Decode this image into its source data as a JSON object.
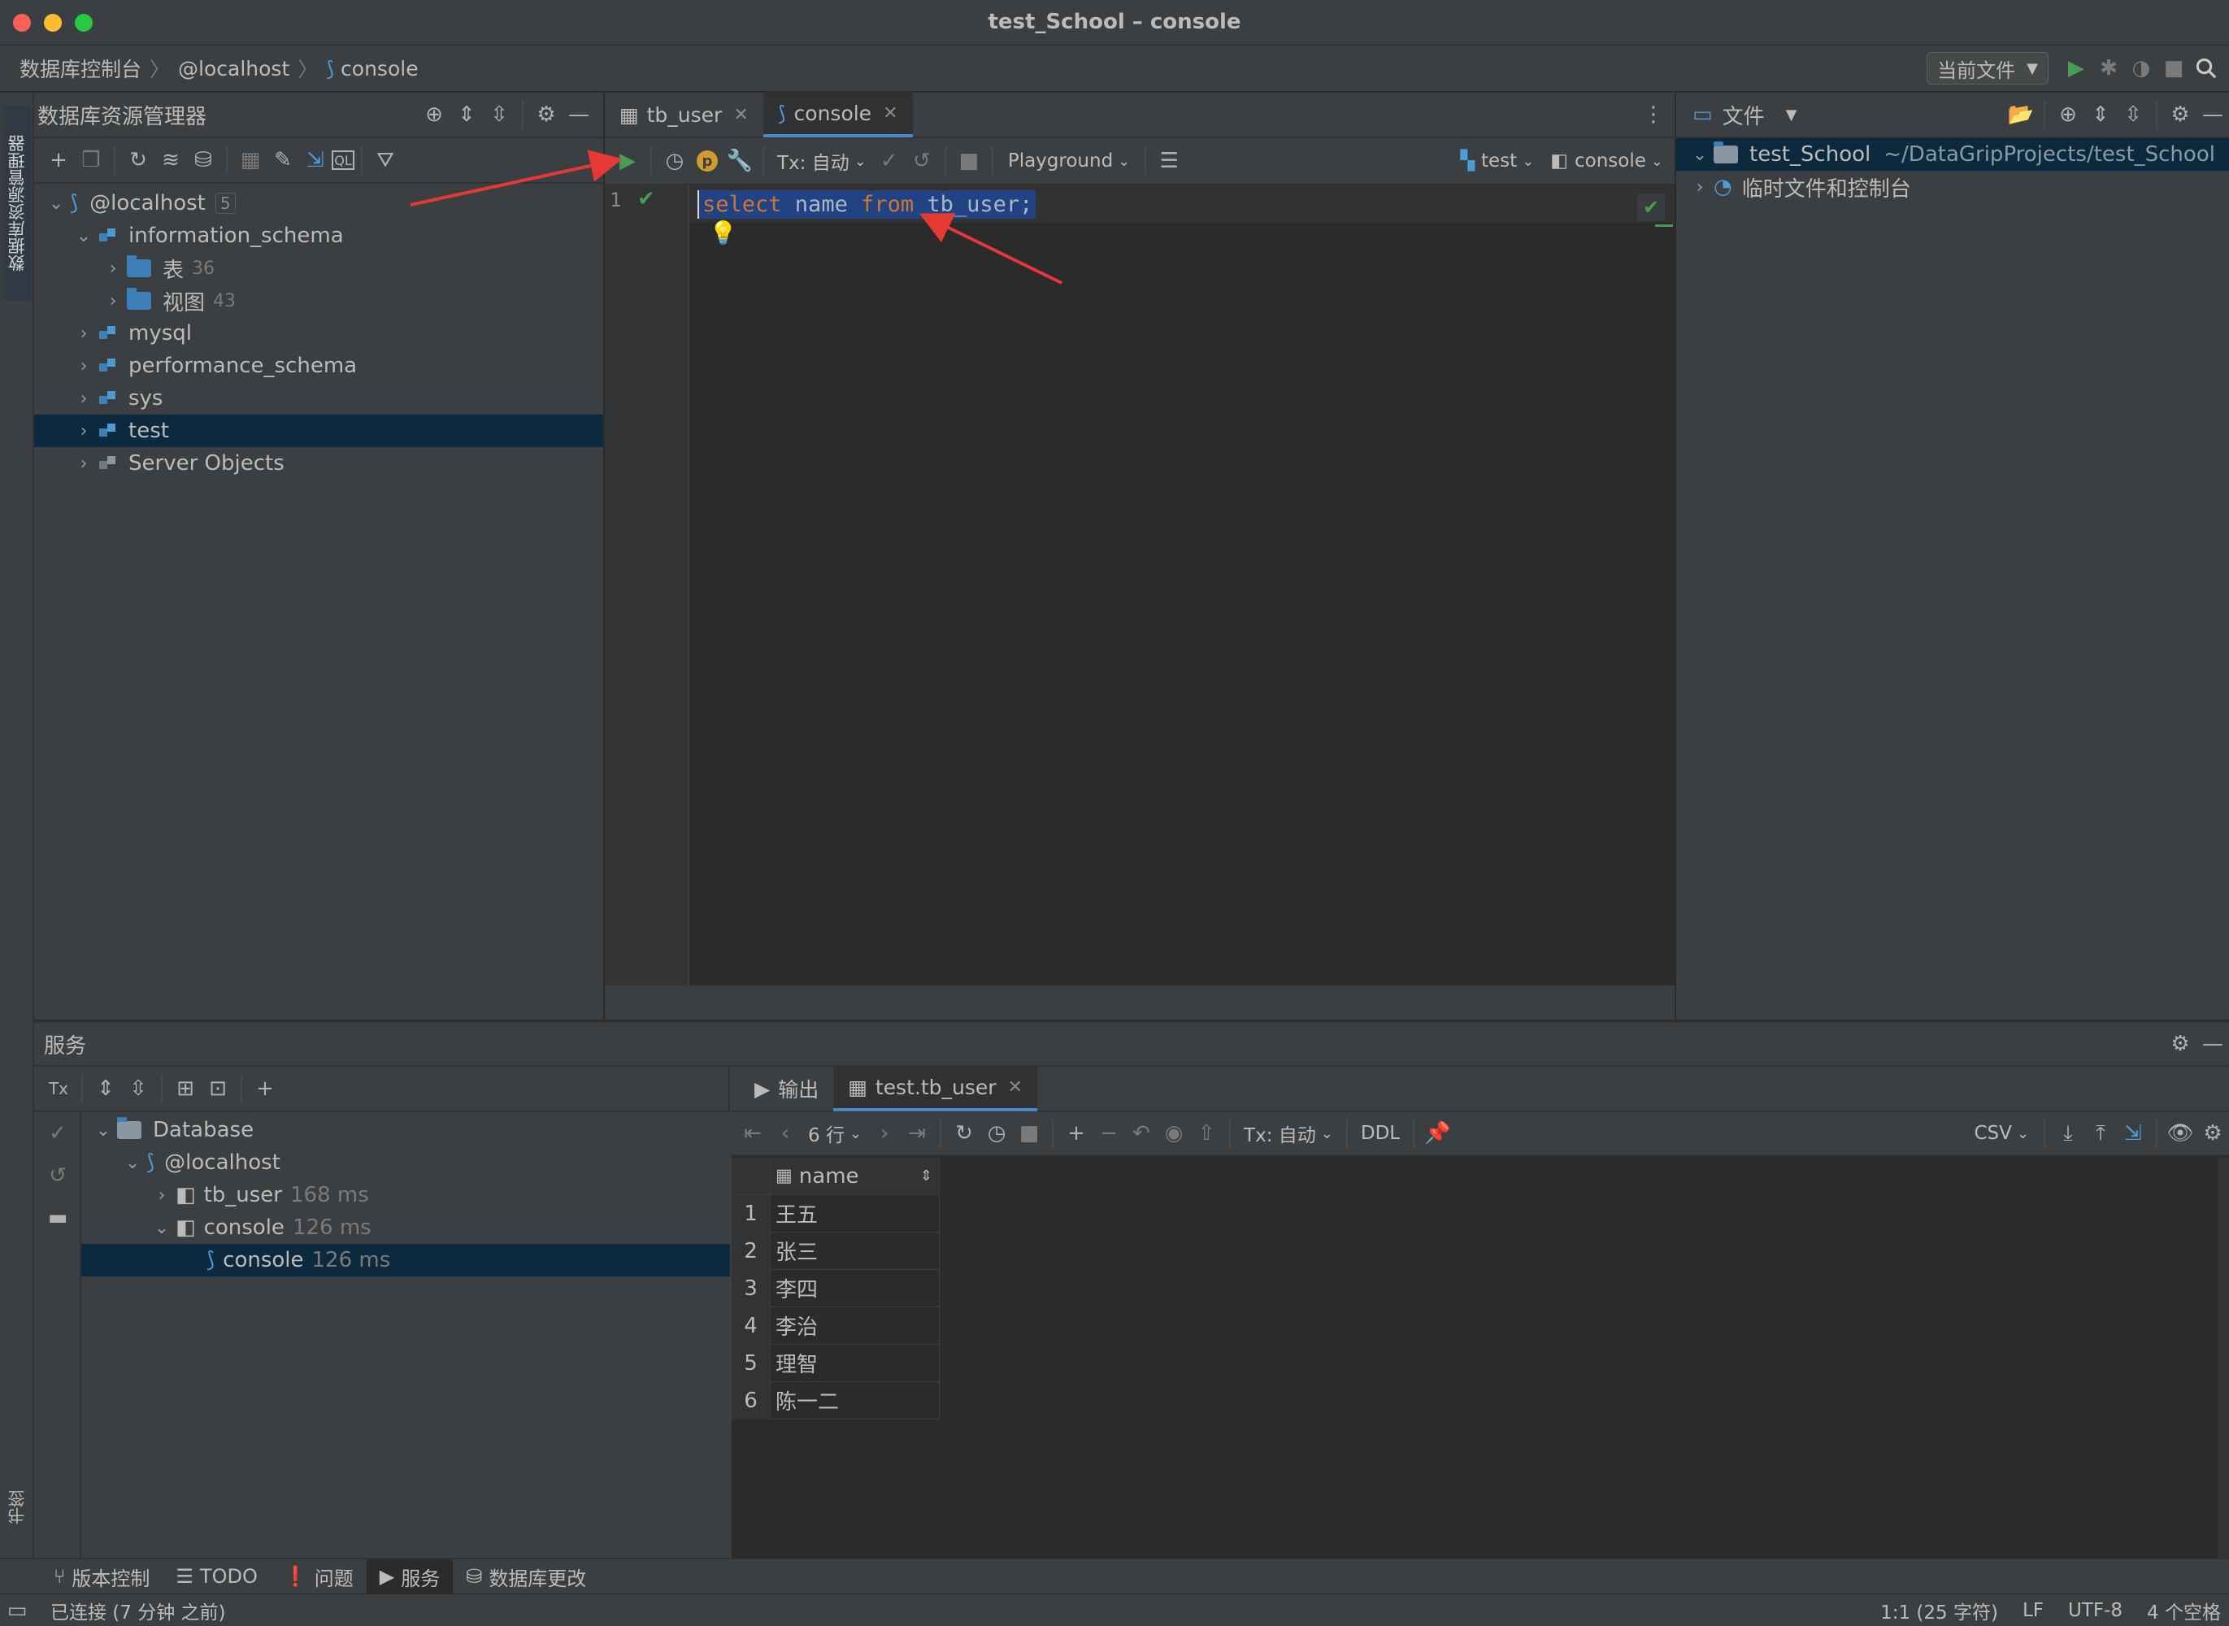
{
  "window": {
    "title": "test_School – console"
  },
  "breadcrumb": {
    "root": "数据库控制台",
    "host": "@localhost",
    "console": "console"
  },
  "navbar": {
    "run_config": "当前文件"
  },
  "left_strip": {
    "db_explorer_label": "数据库资源管理器",
    "bookmarks_label": "书签"
  },
  "db_explorer": {
    "title": "数据库资源管理器",
    "tree": {
      "host": "@localhost",
      "host_count": "5",
      "schema": "information_schema",
      "tables_label": "表",
      "tables_count": "36",
      "views_label": "视图",
      "views_count": "43",
      "mysql": "mysql",
      "performance_schema": "performance_schema",
      "sys": "sys",
      "test": "test",
      "server_objects": "Server Objects"
    }
  },
  "editor": {
    "tabs": [
      {
        "label": "tb_user"
      },
      {
        "label": "console"
      }
    ],
    "tx_label": "Tx: 自动",
    "playground_label": "Playground",
    "schema_selector": "test",
    "session_selector": "console",
    "line_number": "1",
    "code": {
      "kw1": "select",
      "t1": " name ",
      "kw2": "from",
      "t2": " tb_user;"
    }
  },
  "files": {
    "title": "文件",
    "project": "test_School",
    "project_path": "~/DataGripProjects/test_School",
    "scratches": "临时文件和控制台"
  },
  "services": {
    "title": "服务",
    "tree": {
      "database": "Database",
      "host": "@localhost",
      "tb_user": "tb_user",
      "tb_user_time": "168 ms",
      "console": "console",
      "console_time": "126 ms",
      "console_child": "console",
      "console_child_time": "126 ms"
    },
    "result_tabs": {
      "output": "输出",
      "table": "test.tb_user"
    },
    "rows_label": "6 行",
    "tx_label": "Tx: 自动",
    "ddl_label": "DDL",
    "csv_label": "CSV",
    "column_header": "name",
    "rows": [
      {
        "n": "1",
        "name": "王五"
      },
      {
        "n": "2",
        "name": "张三"
      },
      {
        "n": "3",
        "name": "李四"
      },
      {
        "n": "4",
        "name": "李治"
      },
      {
        "n": "5",
        "name": "理智"
      },
      {
        "n": "6",
        "name": "陈一二"
      }
    ]
  },
  "bottom_tabs": {
    "vcs": "版本控制",
    "todo": "TODO",
    "problems": "问题",
    "services": "服务",
    "db_changes": "数据库更改"
  },
  "status": {
    "left": "已连接 (7 分钟 之前)",
    "position": "1:1 (25 字符)",
    "line_sep": "LF",
    "encoding": "UTF-8",
    "indent": "4 个空格"
  },
  "colors": {
    "accent": "#4a88c7",
    "run_green": "#499c54",
    "selection": "#214283",
    "keyword": "#cc7832",
    "arrow": "#e53935"
  }
}
